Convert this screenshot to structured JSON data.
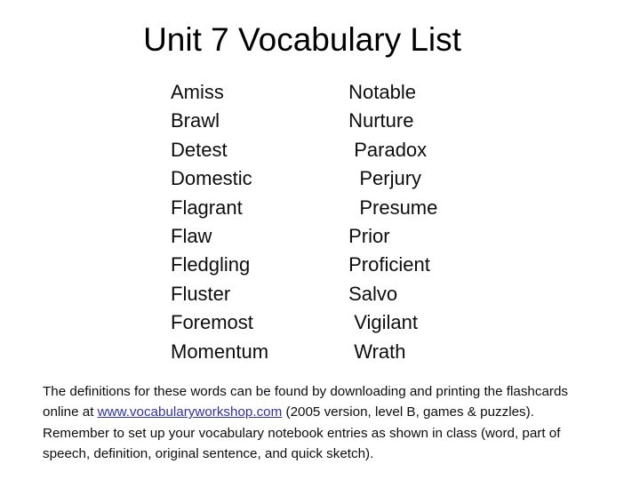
{
  "slide": {
    "title": "Unit 7 Vocabulary List",
    "background_color": "#ffffff",
    "text_color": "#0d0d0d",
    "link_color": "#3232a0"
  },
  "vocabulary": {
    "column_left": [
      "Amiss",
      "Brawl",
      "Detest",
      "Domestic",
      "Flagrant",
      "Flaw",
      "Fledgling",
      "Fluster",
      "Foremost",
      "Momentum"
    ],
    "column_right": [
      " Notable",
      " Nurture",
      "  Paradox",
      "   Perjury",
      "   Presume",
      " Prior",
      " Proficient",
      " Salvo",
      "  Vigilant",
      "  Wrath"
    ]
  },
  "note": {
    "part1": "The definitions for these words can be found by downloading and printing the flashcards online at ",
    "link": "www.vocabularyworkshop.com",
    "part2": " (2005 version, level B, games & puzzles). Remember to set up your vocabulary notebook entries as shown in class (word, part of speech, definition, original sentence, and quick sketch)."
  }
}
